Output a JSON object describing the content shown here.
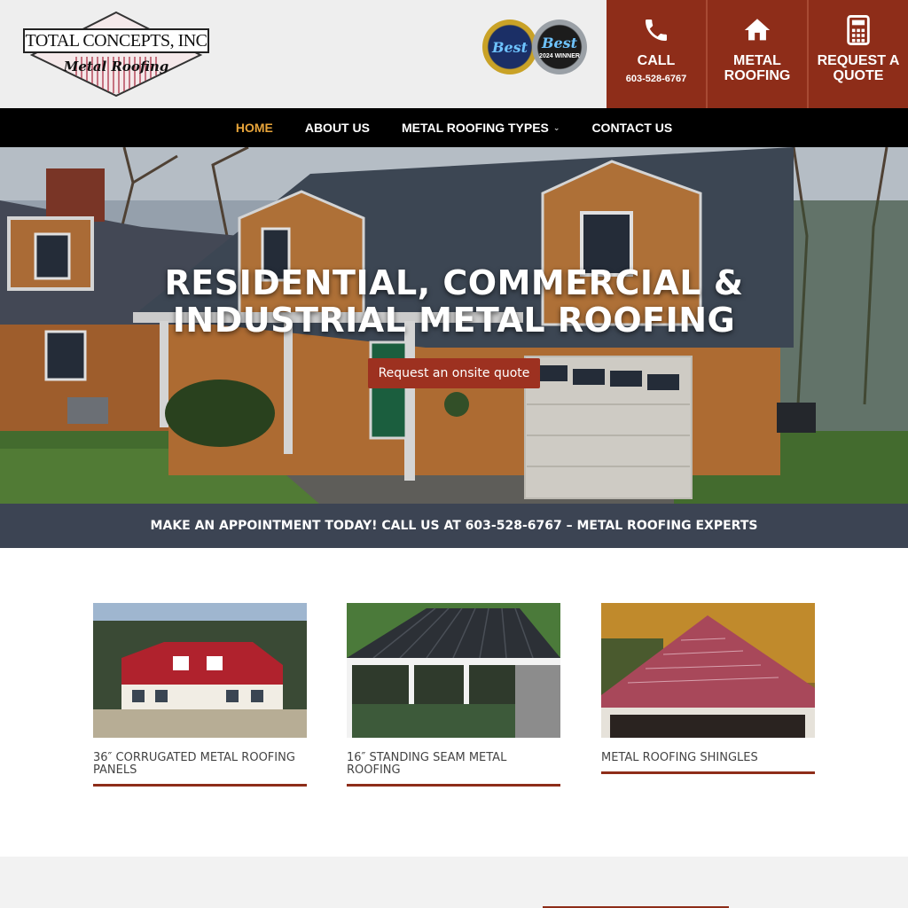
{
  "header": {
    "logo": {
      "name": "TOTAL CONCEPTS, INC",
      "tagline": "Metal Roofing"
    },
    "badges": [
      {
        "title": "Best",
        "subtitle": ""
      },
      {
        "title": "Best",
        "subtitle": "2024 WINNER"
      }
    ],
    "cta": {
      "call": {
        "label": "CALL",
        "sub": "603-528-6767",
        "icon": "phone-icon"
      },
      "metal": {
        "label": "METAL ROOFING",
        "icon": "house-icon"
      },
      "quote": {
        "label": "REQUEST A QUOTE",
        "icon": "calculator-icon"
      }
    },
    "accent_color": "#8e2d19"
  },
  "nav": {
    "items": [
      {
        "label": "HOME",
        "active": true
      },
      {
        "label": "ABOUT US"
      },
      {
        "label": "METAL ROOFING TYPES",
        "has_dropdown": true
      },
      {
        "label": "CONTACT US"
      }
    ]
  },
  "hero": {
    "title": "RESIDENTIAL, COMMERCIAL & INDUSTRIAL METAL ROOFING",
    "button": "Request an onsite quote"
  },
  "appointment": {
    "text": "MAKE AN APPOINTMENT TODAY! CALL US AT 603-528-6767 – METAL ROOFING EXPERTS"
  },
  "cards": [
    {
      "title": "36″ CORRUGATED METAL ROOFING PANELS"
    },
    {
      "title": "16″ STANDING SEAM METAL ROOFING"
    },
    {
      "title": "METAL ROOFING SHINGLES"
    }
  ]
}
